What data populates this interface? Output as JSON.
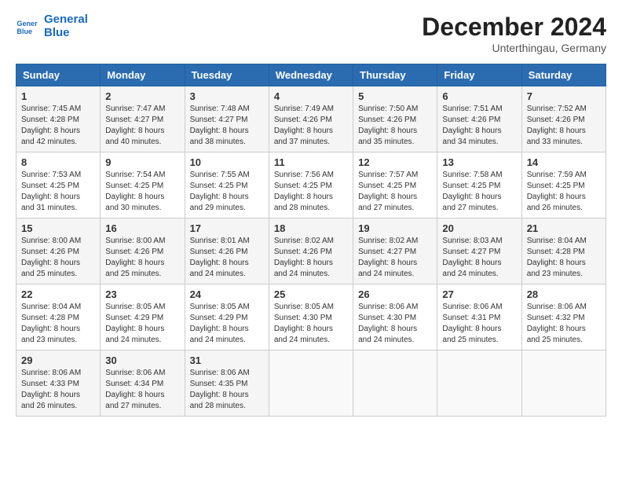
{
  "header": {
    "logo_line1": "General",
    "logo_line2": "Blue",
    "month": "December 2024",
    "location": "Unterthingau, Germany"
  },
  "weekdays": [
    "Sunday",
    "Monday",
    "Tuesday",
    "Wednesday",
    "Thursday",
    "Friday",
    "Saturday"
  ],
  "weeks": [
    [
      {
        "day": "1",
        "sunrise": "7:45 AM",
        "sunset": "4:28 PM",
        "daylight": "8 hours and 42 minutes."
      },
      {
        "day": "2",
        "sunrise": "7:47 AM",
        "sunset": "4:27 PM",
        "daylight": "8 hours and 40 minutes."
      },
      {
        "day": "3",
        "sunrise": "7:48 AM",
        "sunset": "4:27 PM",
        "daylight": "8 hours and 38 minutes."
      },
      {
        "day": "4",
        "sunrise": "7:49 AM",
        "sunset": "4:26 PM",
        "daylight": "8 hours and 37 minutes."
      },
      {
        "day": "5",
        "sunrise": "7:50 AM",
        "sunset": "4:26 PM",
        "daylight": "8 hours and 35 minutes."
      },
      {
        "day": "6",
        "sunrise": "7:51 AM",
        "sunset": "4:26 PM",
        "daylight": "8 hours and 34 minutes."
      },
      {
        "day": "7",
        "sunrise": "7:52 AM",
        "sunset": "4:26 PM",
        "daylight": "8 hours and 33 minutes."
      }
    ],
    [
      {
        "day": "8",
        "sunrise": "7:53 AM",
        "sunset": "4:25 PM",
        "daylight": "8 hours and 31 minutes."
      },
      {
        "day": "9",
        "sunrise": "7:54 AM",
        "sunset": "4:25 PM",
        "daylight": "8 hours and 30 minutes."
      },
      {
        "day": "10",
        "sunrise": "7:55 AM",
        "sunset": "4:25 PM",
        "daylight": "8 hours and 29 minutes."
      },
      {
        "day": "11",
        "sunrise": "7:56 AM",
        "sunset": "4:25 PM",
        "daylight": "8 hours and 28 minutes."
      },
      {
        "day": "12",
        "sunrise": "7:57 AM",
        "sunset": "4:25 PM",
        "daylight": "8 hours and 27 minutes."
      },
      {
        "day": "13",
        "sunrise": "7:58 AM",
        "sunset": "4:25 PM",
        "daylight": "8 hours and 27 minutes."
      },
      {
        "day": "14",
        "sunrise": "7:59 AM",
        "sunset": "4:25 PM",
        "daylight": "8 hours and 26 minutes."
      }
    ],
    [
      {
        "day": "15",
        "sunrise": "8:00 AM",
        "sunset": "4:26 PM",
        "daylight": "8 hours and 25 minutes."
      },
      {
        "day": "16",
        "sunrise": "8:00 AM",
        "sunset": "4:26 PM",
        "daylight": "8 hours and 25 minutes."
      },
      {
        "day": "17",
        "sunrise": "8:01 AM",
        "sunset": "4:26 PM",
        "daylight": "8 hours and 24 minutes."
      },
      {
        "day": "18",
        "sunrise": "8:02 AM",
        "sunset": "4:26 PM",
        "daylight": "8 hours and 24 minutes."
      },
      {
        "day": "19",
        "sunrise": "8:02 AM",
        "sunset": "4:27 PM",
        "daylight": "8 hours and 24 minutes."
      },
      {
        "day": "20",
        "sunrise": "8:03 AM",
        "sunset": "4:27 PM",
        "daylight": "8 hours and 24 minutes."
      },
      {
        "day": "21",
        "sunrise": "8:04 AM",
        "sunset": "4:28 PM",
        "daylight": "8 hours and 23 minutes."
      }
    ],
    [
      {
        "day": "22",
        "sunrise": "8:04 AM",
        "sunset": "4:28 PM",
        "daylight": "8 hours and 23 minutes."
      },
      {
        "day": "23",
        "sunrise": "8:05 AM",
        "sunset": "4:29 PM",
        "daylight": "8 hours and 24 minutes."
      },
      {
        "day": "24",
        "sunrise": "8:05 AM",
        "sunset": "4:29 PM",
        "daylight": "8 hours and 24 minutes."
      },
      {
        "day": "25",
        "sunrise": "8:05 AM",
        "sunset": "4:30 PM",
        "daylight": "8 hours and 24 minutes."
      },
      {
        "day": "26",
        "sunrise": "8:06 AM",
        "sunset": "4:30 PM",
        "daylight": "8 hours and 24 minutes."
      },
      {
        "day": "27",
        "sunrise": "8:06 AM",
        "sunset": "4:31 PM",
        "daylight": "8 hours and 25 minutes."
      },
      {
        "day": "28",
        "sunrise": "8:06 AM",
        "sunset": "4:32 PM",
        "daylight": "8 hours and 25 minutes."
      }
    ],
    [
      {
        "day": "29",
        "sunrise": "8:06 AM",
        "sunset": "4:33 PM",
        "daylight": "8 hours and 26 minutes."
      },
      {
        "day": "30",
        "sunrise": "8:06 AM",
        "sunset": "4:34 PM",
        "daylight": "8 hours and 27 minutes."
      },
      {
        "day": "31",
        "sunrise": "8:06 AM",
        "sunset": "4:35 PM",
        "daylight": "8 hours and 28 minutes."
      },
      null,
      null,
      null,
      null
    ]
  ]
}
